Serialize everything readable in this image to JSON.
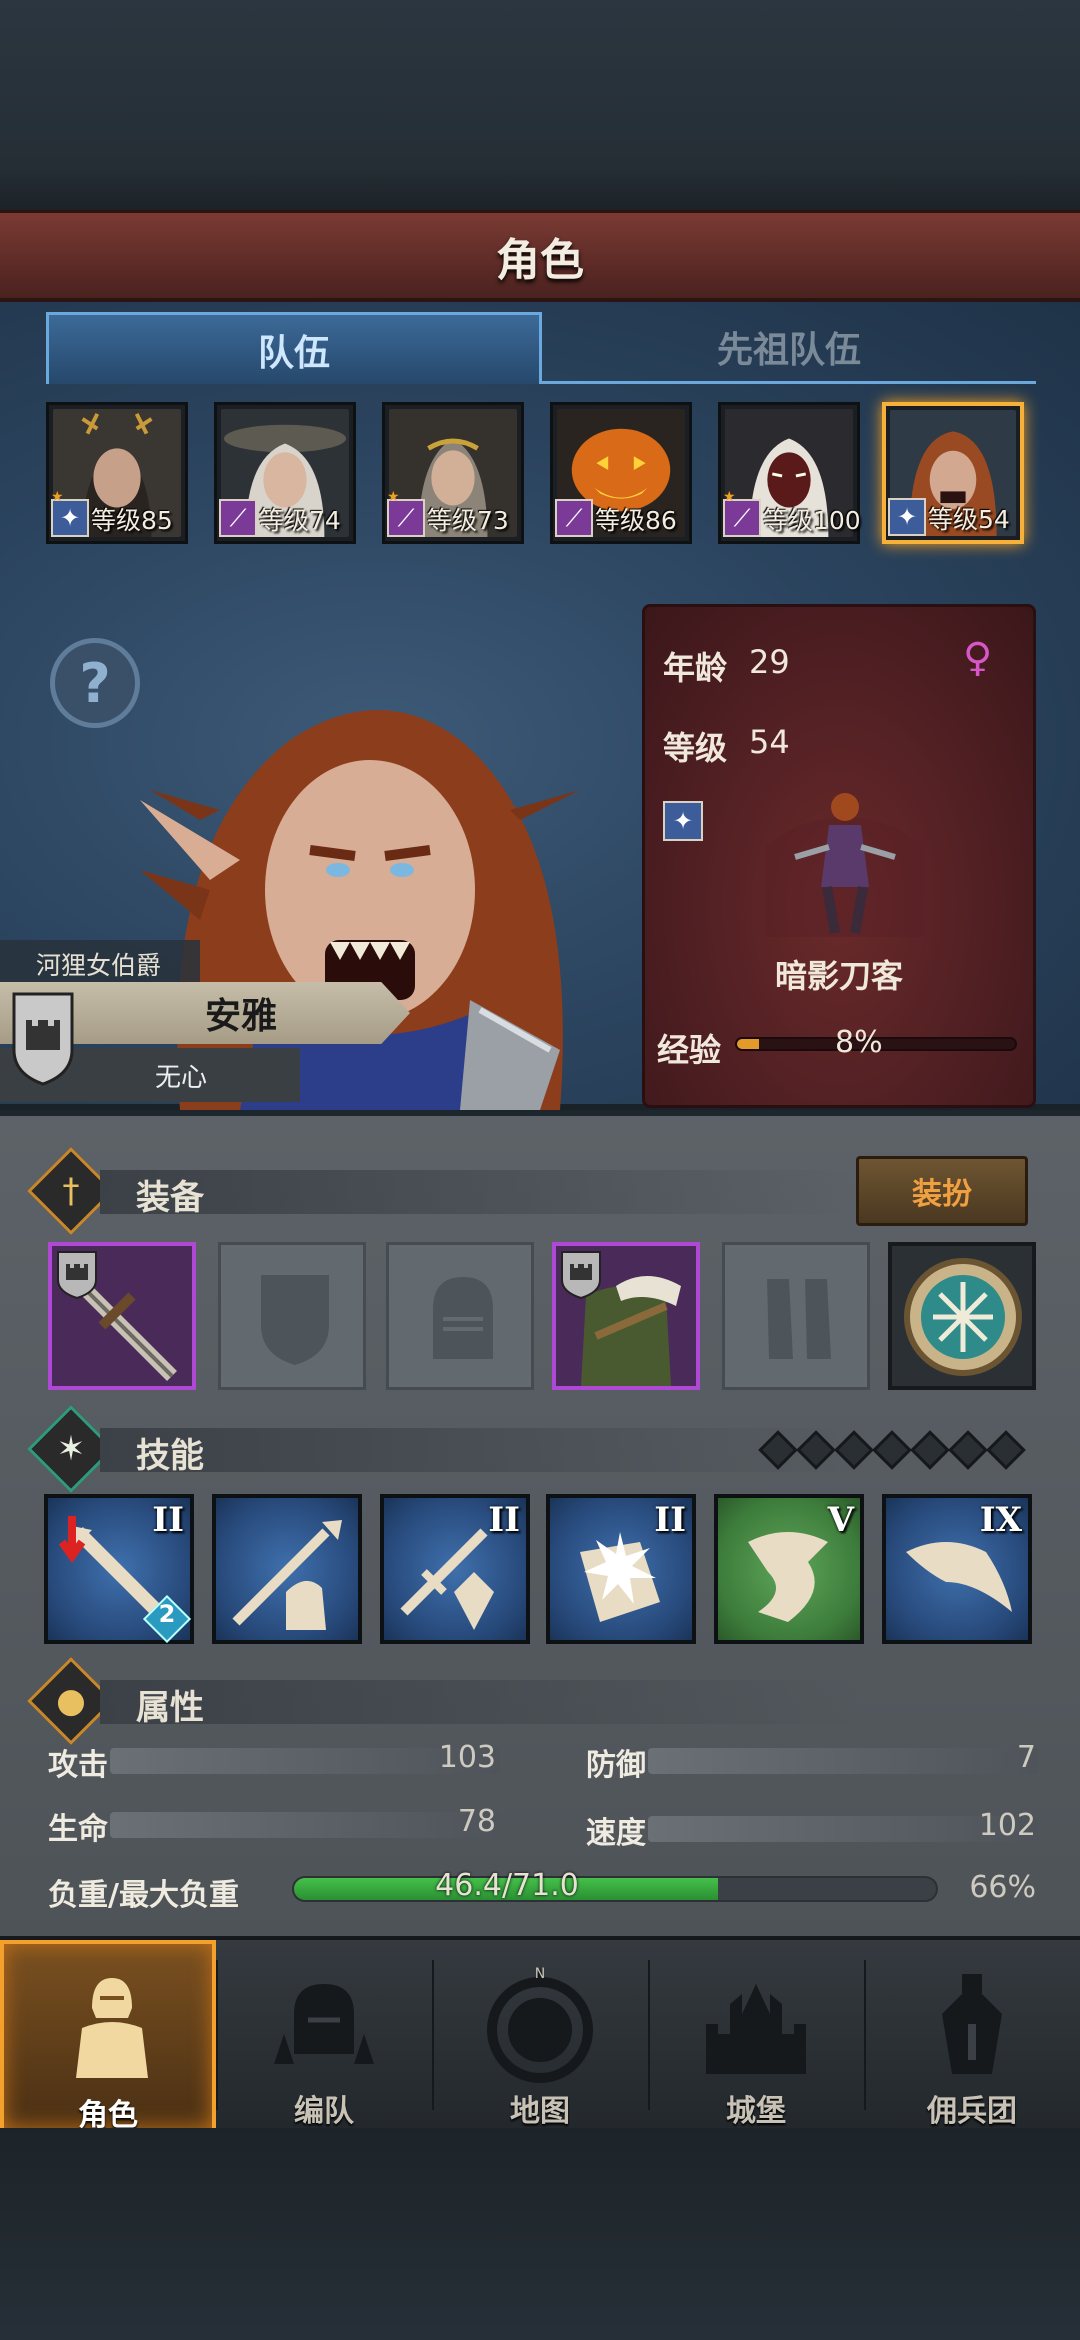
{
  "screen_title": "角色",
  "tabs": [
    {
      "label": "队伍",
      "active": true
    },
    {
      "label": "先祖队伍",
      "active": false
    }
  ],
  "roster": [
    {
      "level_label": "等级85",
      "class_icon": "blade-icon",
      "starred": true,
      "selected": false
    },
    {
      "level_label": "等级74",
      "class_icon": "staff-icon",
      "starred": false,
      "selected": false
    },
    {
      "level_label": "等级73",
      "class_icon": "staff-icon",
      "starred": true,
      "selected": false
    },
    {
      "level_label": "等级86",
      "class_icon": "staff-icon",
      "starred": false,
      "selected": false
    },
    {
      "level_label": "等级100",
      "class_icon": "staff-icon",
      "starred": true,
      "selected": false
    },
    {
      "level_label": "等级54",
      "class_icon": "blade-icon",
      "starred": false,
      "selected": true
    }
  ],
  "hero": {
    "title": "河狸女伯爵",
    "name": "安雅",
    "trait": "无心"
  },
  "stat_card": {
    "age_label": "年龄",
    "age_value": "29",
    "level_label": "等级",
    "level_value": "54",
    "gender_icon": "female-icon",
    "class_name": "暗影刀客",
    "exp_label": "经验",
    "exp_percent_text": "8%",
    "exp_fraction": 0.08
  },
  "equipment": {
    "title": "装备",
    "dress_button": "装扮",
    "slots": [
      {
        "name": "weapon-slot",
        "filled": true
      },
      {
        "name": "shield-slot",
        "filled": false
      },
      {
        "name": "helmet-slot",
        "filled": false
      },
      {
        "name": "armor-slot",
        "filled": true
      },
      {
        "name": "boots-slot",
        "filled": false
      },
      {
        "name": "amulet-slot",
        "filled": true
      }
    ]
  },
  "skills": {
    "title": "技能",
    "pip_count": 7,
    "items": [
      {
        "rank": "II",
        "color": "blue",
        "badge": "2"
      },
      {
        "rank": "",
        "color": "blue",
        "badge": ""
      },
      {
        "rank": "II",
        "color": "blue",
        "badge": ""
      },
      {
        "rank": "II",
        "color": "blue",
        "badge": ""
      },
      {
        "rank": "V",
        "color": "green",
        "badge": ""
      },
      {
        "rank": "IX",
        "color": "blue",
        "badge": ""
      }
    ]
  },
  "attributes": {
    "title": "属性",
    "attack_label": "攻击",
    "attack_value": "103",
    "defense_label": "防御",
    "defense_value": "7",
    "hp_label": "生命",
    "hp_value": "78",
    "speed_label": "速度",
    "speed_value": "102",
    "load_label": "负重/最大负重",
    "load_text": "46.4/71.0",
    "load_percent_text": "66%",
    "load_fraction": 0.66
  },
  "nav": [
    {
      "label": "角色",
      "active": true
    },
    {
      "label": "编队",
      "active": false
    },
    {
      "label": "地图",
      "active": false
    },
    {
      "label": "城堡",
      "active": false
    },
    {
      "label": "佣兵团",
      "active": false
    }
  ],
  "colors": {
    "accent_gold": "#f6b13a",
    "tab_blue": "#6aa8dd",
    "epic_purple": "#b048d6",
    "banner_red": "#7a3b33",
    "load_green": "#45c04a"
  }
}
